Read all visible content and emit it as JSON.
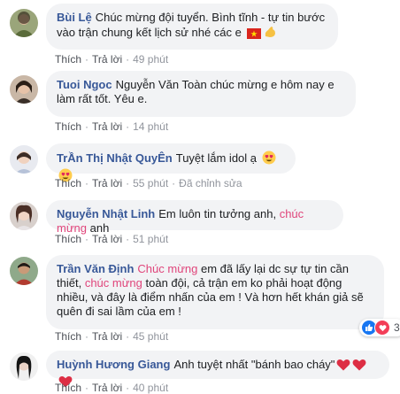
{
  "labels": {
    "like": "Thích",
    "reply": "Trả lời",
    "edited": "Đã chỉnh sửa"
  },
  "comments": [
    {
      "author": "Bùi Lệ",
      "text": "Chúc mừng đội tuyển. Bình tĩnh - tự tin bước vào trận chung kết lịch sử nhé các e",
      "time": "49 phút",
      "emojis": [
        "vietnam-flag-icon",
        "flexed-biceps-icon"
      ]
    },
    {
      "author": "Tuoi Ngoc",
      "text": "Nguyễn Văn Toàn chúc mừng e hôm nay e làm rất tốt. Yêu e.",
      "time": "14 phút"
    },
    {
      "author": "TrẦn Thị Nhật QuyÊn",
      "text": "Tuyệt lắm idol ạ",
      "time": "55 phút",
      "edited": true,
      "emojis": [
        "heart-eyes-icon",
        "heart-eyes-icon"
      ]
    },
    {
      "author": "Nguyễn Nhật Linh",
      "text_before": "Em luôn tin tưởng anh,",
      "highlight": "chúc mừng",
      "text_after": "anh",
      "time": "51 phút"
    },
    {
      "author": "Trần Văn Định",
      "highlight": "Chúc mừng",
      "text_after": "em đã lấy lại dc sự tự tin cần thiết,",
      "highlight2": "chúc mừng",
      "text_after2": "toàn đội, cả trận em ko phải hoạt động nhiều, và đây là điểm nhấn của em ! Và hơn hết khán giả sẽ quên đi sai lầm của em !",
      "time": "45 phút",
      "reaction_count": "3"
    },
    {
      "author": "Huỳnh Hương Giang",
      "text": "Anh tuyệt nhất \"bánh bao cháy\"",
      "time": "40 phút",
      "emojis": [
        "heart-icon",
        "heart-icon",
        "heart-icon"
      ]
    }
  ],
  "colors": {
    "author": "#385898",
    "highlight": "#e0457b",
    "bubble": "#f2f3f5"
  }
}
